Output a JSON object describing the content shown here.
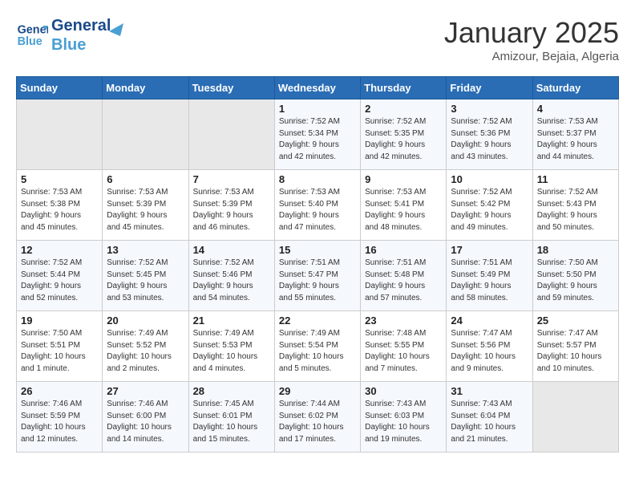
{
  "logo": {
    "line1": "General",
    "line2": "Blue"
  },
  "title": "January 2025",
  "subtitle": "Amizour, Bejaia, Algeria",
  "days_of_week": [
    "Sunday",
    "Monday",
    "Tuesday",
    "Wednesday",
    "Thursday",
    "Friday",
    "Saturday"
  ],
  "weeks": [
    [
      {
        "num": "",
        "info": ""
      },
      {
        "num": "",
        "info": ""
      },
      {
        "num": "",
        "info": ""
      },
      {
        "num": "1",
        "info": "Sunrise: 7:52 AM\nSunset: 5:34 PM\nDaylight: 9 hours\nand 42 minutes."
      },
      {
        "num": "2",
        "info": "Sunrise: 7:52 AM\nSunset: 5:35 PM\nDaylight: 9 hours\nand 42 minutes."
      },
      {
        "num": "3",
        "info": "Sunrise: 7:52 AM\nSunset: 5:36 PM\nDaylight: 9 hours\nand 43 minutes."
      },
      {
        "num": "4",
        "info": "Sunrise: 7:53 AM\nSunset: 5:37 PM\nDaylight: 9 hours\nand 44 minutes."
      }
    ],
    [
      {
        "num": "5",
        "info": "Sunrise: 7:53 AM\nSunset: 5:38 PM\nDaylight: 9 hours\nand 45 minutes."
      },
      {
        "num": "6",
        "info": "Sunrise: 7:53 AM\nSunset: 5:39 PM\nDaylight: 9 hours\nand 45 minutes."
      },
      {
        "num": "7",
        "info": "Sunrise: 7:53 AM\nSunset: 5:39 PM\nDaylight: 9 hours\nand 46 minutes."
      },
      {
        "num": "8",
        "info": "Sunrise: 7:53 AM\nSunset: 5:40 PM\nDaylight: 9 hours\nand 47 minutes."
      },
      {
        "num": "9",
        "info": "Sunrise: 7:53 AM\nSunset: 5:41 PM\nDaylight: 9 hours\nand 48 minutes."
      },
      {
        "num": "10",
        "info": "Sunrise: 7:52 AM\nSunset: 5:42 PM\nDaylight: 9 hours\nand 49 minutes."
      },
      {
        "num": "11",
        "info": "Sunrise: 7:52 AM\nSunset: 5:43 PM\nDaylight: 9 hours\nand 50 minutes."
      }
    ],
    [
      {
        "num": "12",
        "info": "Sunrise: 7:52 AM\nSunset: 5:44 PM\nDaylight: 9 hours\nand 52 minutes."
      },
      {
        "num": "13",
        "info": "Sunrise: 7:52 AM\nSunset: 5:45 PM\nDaylight: 9 hours\nand 53 minutes."
      },
      {
        "num": "14",
        "info": "Sunrise: 7:52 AM\nSunset: 5:46 PM\nDaylight: 9 hours\nand 54 minutes."
      },
      {
        "num": "15",
        "info": "Sunrise: 7:51 AM\nSunset: 5:47 PM\nDaylight: 9 hours\nand 55 minutes."
      },
      {
        "num": "16",
        "info": "Sunrise: 7:51 AM\nSunset: 5:48 PM\nDaylight: 9 hours\nand 57 minutes."
      },
      {
        "num": "17",
        "info": "Sunrise: 7:51 AM\nSunset: 5:49 PM\nDaylight: 9 hours\nand 58 minutes."
      },
      {
        "num": "18",
        "info": "Sunrise: 7:50 AM\nSunset: 5:50 PM\nDaylight: 9 hours\nand 59 minutes."
      }
    ],
    [
      {
        "num": "19",
        "info": "Sunrise: 7:50 AM\nSunset: 5:51 PM\nDaylight: 10 hours\nand 1 minute."
      },
      {
        "num": "20",
        "info": "Sunrise: 7:49 AM\nSunset: 5:52 PM\nDaylight: 10 hours\nand 2 minutes."
      },
      {
        "num": "21",
        "info": "Sunrise: 7:49 AM\nSunset: 5:53 PM\nDaylight: 10 hours\nand 4 minutes."
      },
      {
        "num": "22",
        "info": "Sunrise: 7:49 AM\nSunset: 5:54 PM\nDaylight: 10 hours\nand 5 minutes."
      },
      {
        "num": "23",
        "info": "Sunrise: 7:48 AM\nSunset: 5:55 PM\nDaylight: 10 hours\nand 7 minutes."
      },
      {
        "num": "24",
        "info": "Sunrise: 7:47 AM\nSunset: 5:56 PM\nDaylight: 10 hours\nand 9 minutes."
      },
      {
        "num": "25",
        "info": "Sunrise: 7:47 AM\nSunset: 5:57 PM\nDaylight: 10 hours\nand 10 minutes."
      }
    ],
    [
      {
        "num": "26",
        "info": "Sunrise: 7:46 AM\nSunset: 5:59 PM\nDaylight: 10 hours\nand 12 minutes."
      },
      {
        "num": "27",
        "info": "Sunrise: 7:46 AM\nSunset: 6:00 PM\nDaylight: 10 hours\nand 14 minutes."
      },
      {
        "num": "28",
        "info": "Sunrise: 7:45 AM\nSunset: 6:01 PM\nDaylight: 10 hours\nand 15 minutes."
      },
      {
        "num": "29",
        "info": "Sunrise: 7:44 AM\nSunset: 6:02 PM\nDaylight: 10 hours\nand 17 minutes."
      },
      {
        "num": "30",
        "info": "Sunrise: 7:43 AM\nSunset: 6:03 PM\nDaylight: 10 hours\nand 19 minutes."
      },
      {
        "num": "31",
        "info": "Sunrise: 7:43 AM\nSunset: 6:04 PM\nDaylight: 10 hours\nand 21 minutes."
      },
      {
        "num": "",
        "info": ""
      }
    ]
  ]
}
